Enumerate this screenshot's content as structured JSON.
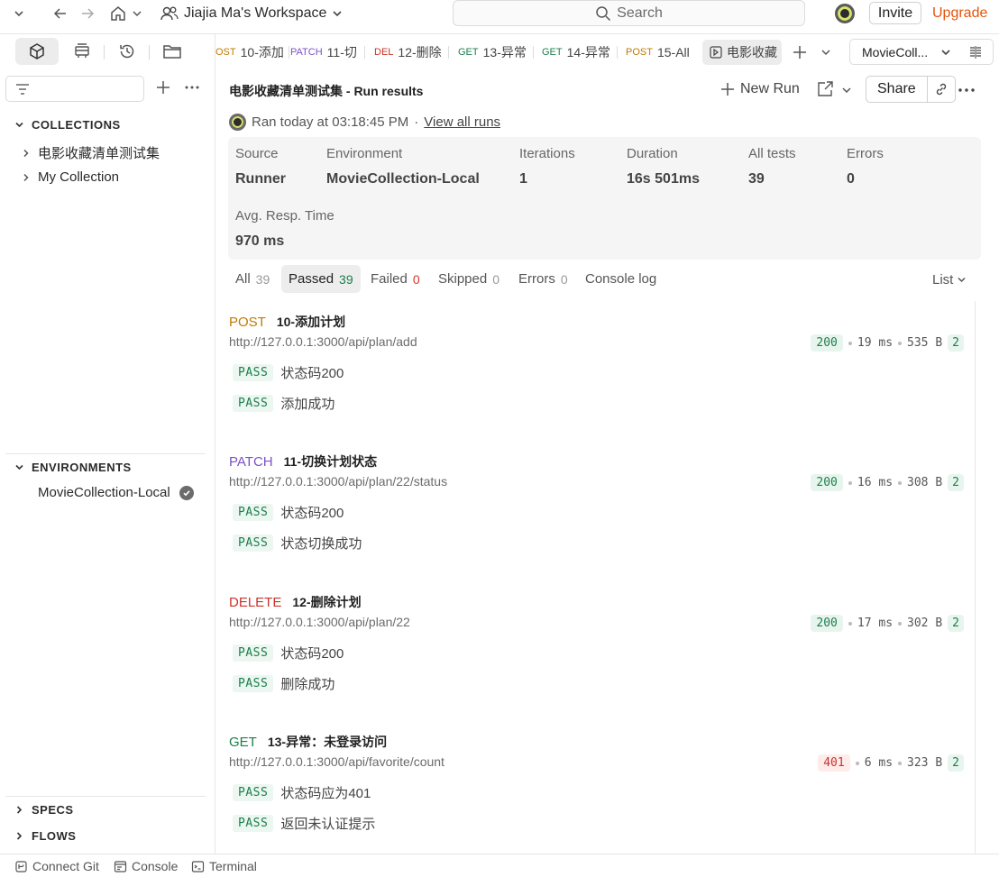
{
  "topbar": {
    "workspace": "Jiajia Ma's Workspace",
    "search_placeholder": "Search",
    "invite": "Invite",
    "upgrade": "Upgrade"
  },
  "sidebar": {
    "collections_label": "COLLECTIONS",
    "collections": [
      "电影收藏清单测试集",
      "My Collection"
    ],
    "environments_label": "ENVIRONMENTS",
    "environment": "MovieCollection-Local",
    "specs_label": "SPECS",
    "flows_label": "FLOWS"
  },
  "tabs": [
    {
      "method": "OST",
      "name": "10-添加",
      "color": "#c27a00"
    },
    {
      "method": "PATCH",
      "name": "11-切",
      "color": "#7a52c7"
    },
    {
      "method": "DEL",
      "name": "12-删除",
      "color": "#c9342b"
    },
    {
      "method": "GET",
      "name": "13-异常",
      "color": "#1b7f4b"
    },
    {
      "method": "GET",
      "name": "14-异常",
      "color": "#1b7f4b"
    },
    {
      "method": "POST",
      "name": "15-All",
      "color": "#c27a00"
    },
    {
      "method": "",
      "name": "电影收藏",
      "color": "#444"
    }
  ],
  "env_selector": "MovieColl...",
  "run": {
    "title": "电影收藏清单测试集 - Run results",
    "new_run": "New Run",
    "share": "Share",
    "ran_text": "Ran today at 03:18:45 PM",
    "separator": "·",
    "view_all": "View all runs"
  },
  "summary": {
    "source": {
      "label": "Source",
      "value": "Runner"
    },
    "environment": {
      "label": "Environment",
      "value": "MovieCollection-Local"
    },
    "iterations": {
      "label": "Iterations",
      "value": "1"
    },
    "duration": {
      "label": "Duration",
      "value": "16s 501ms"
    },
    "all_tests": {
      "label": "All tests",
      "value": "39"
    },
    "errors": {
      "label": "Errors",
      "value": "0"
    },
    "avg_resp": {
      "label": "Avg. Resp. Time",
      "value": "970 ms"
    }
  },
  "filters": {
    "all": {
      "label": "All",
      "count": "39"
    },
    "passed": {
      "label": "Passed",
      "count": "39"
    },
    "failed": {
      "label": "Failed",
      "count": "0"
    },
    "skipped": {
      "label": "Skipped",
      "count": "0"
    },
    "errors": {
      "label": "Errors",
      "count": "0"
    },
    "console": "Console log",
    "view_mode": "List"
  },
  "results": [
    {
      "method": "POST",
      "method_color": "#c27a00",
      "name": "10-添加计划",
      "url": "http://127.0.0.1:3000/api/plan/add",
      "status": "200",
      "time": "19 ms",
      "size": "535 B",
      "count": "2",
      "tests": [
        {
          "badge": "PASS",
          "name": "状态码200"
        },
        {
          "badge": "PASS",
          "name": "添加成功"
        }
      ]
    },
    {
      "method": "PATCH",
      "method_color": "#7a52c7",
      "name": "11-切换计划状态",
      "url": "http://127.0.0.1:3000/api/plan/22/status",
      "status": "200",
      "time": "16 ms",
      "size": "308 B",
      "count": "2",
      "tests": [
        {
          "badge": "PASS",
          "name": "状态码200"
        },
        {
          "badge": "PASS",
          "name": "状态切换成功"
        }
      ]
    },
    {
      "method": "DELETE",
      "method_color": "#c9342b",
      "name": "12-删除计划",
      "url": "http://127.0.0.1:3000/api/plan/22",
      "status": "200",
      "time": "17 ms",
      "size": "302 B",
      "count": "2",
      "tests": [
        {
          "badge": "PASS",
          "name": "状态码200"
        },
        {
          "badge": "PASS",
          "name": "删除成功"
        }
      ]
    },
    {
      "method": "GET",
      "method_color": "#1b7f4b",
      "name": "13-异常：未登录访问",
      "url": "http://127.0.0.1:3000/api/favorite/count",
      "status": "401",
      "time": "6 ms",
      "size": "323 B",
      "count": "2",
      "tests": [
        {
          "badge": "PASS",
          "name": "状态码应为401"
        },
        {
          "badge": "PASS",
          "name": "返回未认证提示"
        }
      ]
    }
  ],
  "bottombar": {
    "connect_git": "Connect Git",
    "console": "Console",
    "terminal": "Terminal"
  }
}
